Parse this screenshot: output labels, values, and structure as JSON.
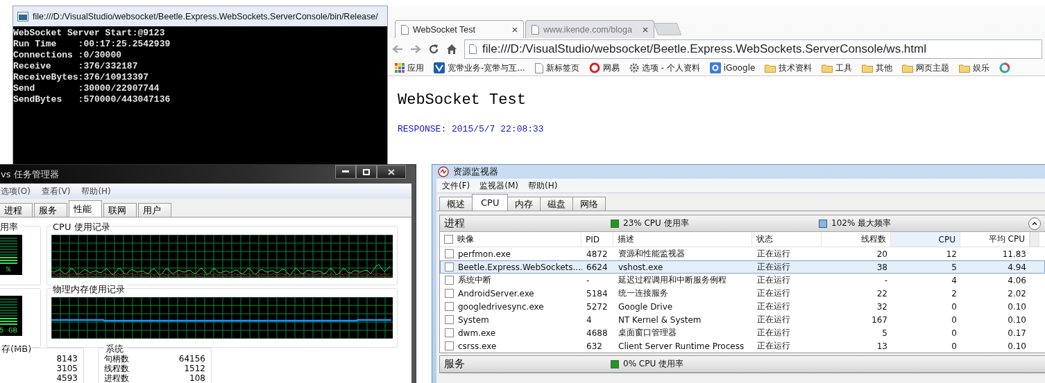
{
  "console_window": {
    "title": "file:///D:/VisualStudio/websocket/Beetle.Express.WebSockets.ServerConsole/bin/Release/",
    "lines": [
      "WebSocket Server Start:@9123",
      "Run Time    :00:17:25.2542939",
      "Connections :0/30000",
      "Receive     :376/332187",
      "ReceiveBytes:376/10913397",
      "Send        :30000/22907744",
      "SendBytes   :570000/443047136"
    ]
  },
  "browser": {
    "tabs": [
      {
        "label": "WebSocket Test",
        "selected": true
      },
      {
        "label": "www.ikende.com/bloga",
        "selected": false
      }
    ],
    "address": "file:///D:/VisualStudio/websocket/Beetle.Express.WebSockets.ServerConsole/ws.html",
    "bookmarks": [
      {
        "kind": "apps",
        "label": "应用"
      },
      {
        "kind": "site",
        "label": "宽带业务-宽带与互..."
      },
      {
        "kind": "page",
        "label": "新标签页"
      },
      {
        "kind": "logo",
        "label": "网易"
      },
      {
        "kind": "gear",
        "label": "选项 - 个人资料"
      },
      {
        "kind": "google",
        "label": "iGoogle"
      },
      {
        "kind": "folder",
        "label": "技术资料"
      },
      {
        "kind": "folder",
        "label": "工具"
      },
      {
        "kind": "folder",
        "label": "其他"
      },
      {
        "kind": "folder",
        "label": "网页主题"
      },
      {
        "kind": "folder",
        "label": "娱乐"
      },
      {
        "kind": "ring"
      }
    ],
    "page": {
      "heading": "WebSocket Test",
      "response": "RESPONSE: 2015/5/7 22:08:33"
    }
  },
  "task_manager": {
    "title": "vs 任务管理器",
    "menu": [
      "选项(O)",
      "查看(V)",
      "帮助(H)"
    ],
    "tabs": [
      {
        "label": "进程",
        "selected": false
      },
      {
        "label": "服务",
        "selected": false
      },
      {
        "label": "性能",
        "selected": true
      },
      {
        "label": "联网",
        "selected": false
      },
      {
        "label": "用户",
        "selected": false
      }
    ],
    "cpu_usage": {
      "title": "用率",
      "reading": "%"
    },
    "cpu_history": {
      "title": "CPU 使用记录"
    },
    "memory_meter": {
      "reading": "5 GB"
    },
    "memory_history": {
      "title": "物理内存使用记录"
    },
    "memory": {
      "title": "存(MB)",
      "values": [
        "8143",
        "3105",
        "4593"
      ]
    },
    "system": {
      "title": "系统",
      "rows": [
        {
          "label": "句柄数",
          "value": "64156"
        },
        {
          "label": "线程数",
          "value": "1512"
        },
        {
          "label": "进程数",
          "value": "108"
        }
      ]
    }
  },
  "resource_monitor": {
    "title": "资源监视器",
    "menu": [
      "文件(F)",
      "监视器(M)",
      "帮助(H)"
    ],
    "tabs": [
      {
        "label": "概述",
        "selected": false
      },
      {
        "label": "CPU",
        "selected": true
      },
      {
        "label": "内存",
        "selected": false
      },
      {
        "label": "磁盘",
        "selected": false
      },
      {
        "label": "网络",
        "selected": false
      }
    ],
    "process_section": {
      "title": "进程",
      "legend": [
        {
          "label": "23% CPU 使用率",
          "color": "#1a9c1a"
        },
        {
          "label": "102% 最大频率",
          "color": "#7fb8f0"
        }
      ]
    },
    "columns": [
      "映像",
      "PID",
      "描述",
      "状态",
      "线程数",
      "CPU",
      "平均 CPU"
    ],
    "header_checked": false,
    "rows": [
      {
        "cells": [
          "perfmon.exe",
          "4872",
          "资源和性能监视器",
          "正在运行",
          "20",
          "12",
          "11.83"
        ],
        "checked": false,
        "selected": false
      },
      {
        "cells": [
          "Beetle.Express.WebSockets....",
          "6624",
          "vshost.exe",
          "正在运行",
          "38",
          "5",
          "4.94"
        ],
        "checked": false,
        "selected": true
      },
      {
        "cells": [
          "系统中断",
          "-",
          "延迟过程调用和中断服务例程",
          "正在运行",
          "-",
          "4",
          "4.06"
        ],
        "checked": false,
        "selected": false
      },
      {
        "cells": [
          "AndroidServer.exe",
          "5184",
          "统一连接服务",
          "正在运行",
          "22",
          "2",
          "2.02"
        ],
        "checked": false,
        "selected": false
      },
      {
        "cells": [
          "googledrivesync.exe",
          "5272",
          "Google Drive",
          "正在运行",
          "32",
          "0",
          "0.10"
        ],
        "checked": false,
        "selected": false
      },
      {
        "cells": [
          "System",
          "4",
          "NT Kernel & System",
          "正在运行",
          "167",
          "0",
          "0.10"
        ],
        "checked": false,
        "selected": false
      },
      {
        "cells": [
          "dwm.exe",
          "4688",
          "桌面窗口管理器",
          "正在运行",
          "5",
          "0",
          "0.17"
        ],
        "checked": false,
        "selected": false
      },
      {
        "cells": [
          "csrss.exe",
          "632",
          "Client Server Runtime Process",
          "正在运行",
          "13",
          "0",
          "0.10"
        ],
        "checked": false,
        "selected": false
      }
    ],
    "services_section": {
      "title": "服务",
      "legend": [
        {
          "label": "0% CPU 使用率",
          "color": "#1a9c1a"
        }
      ]
    }
  }
}
